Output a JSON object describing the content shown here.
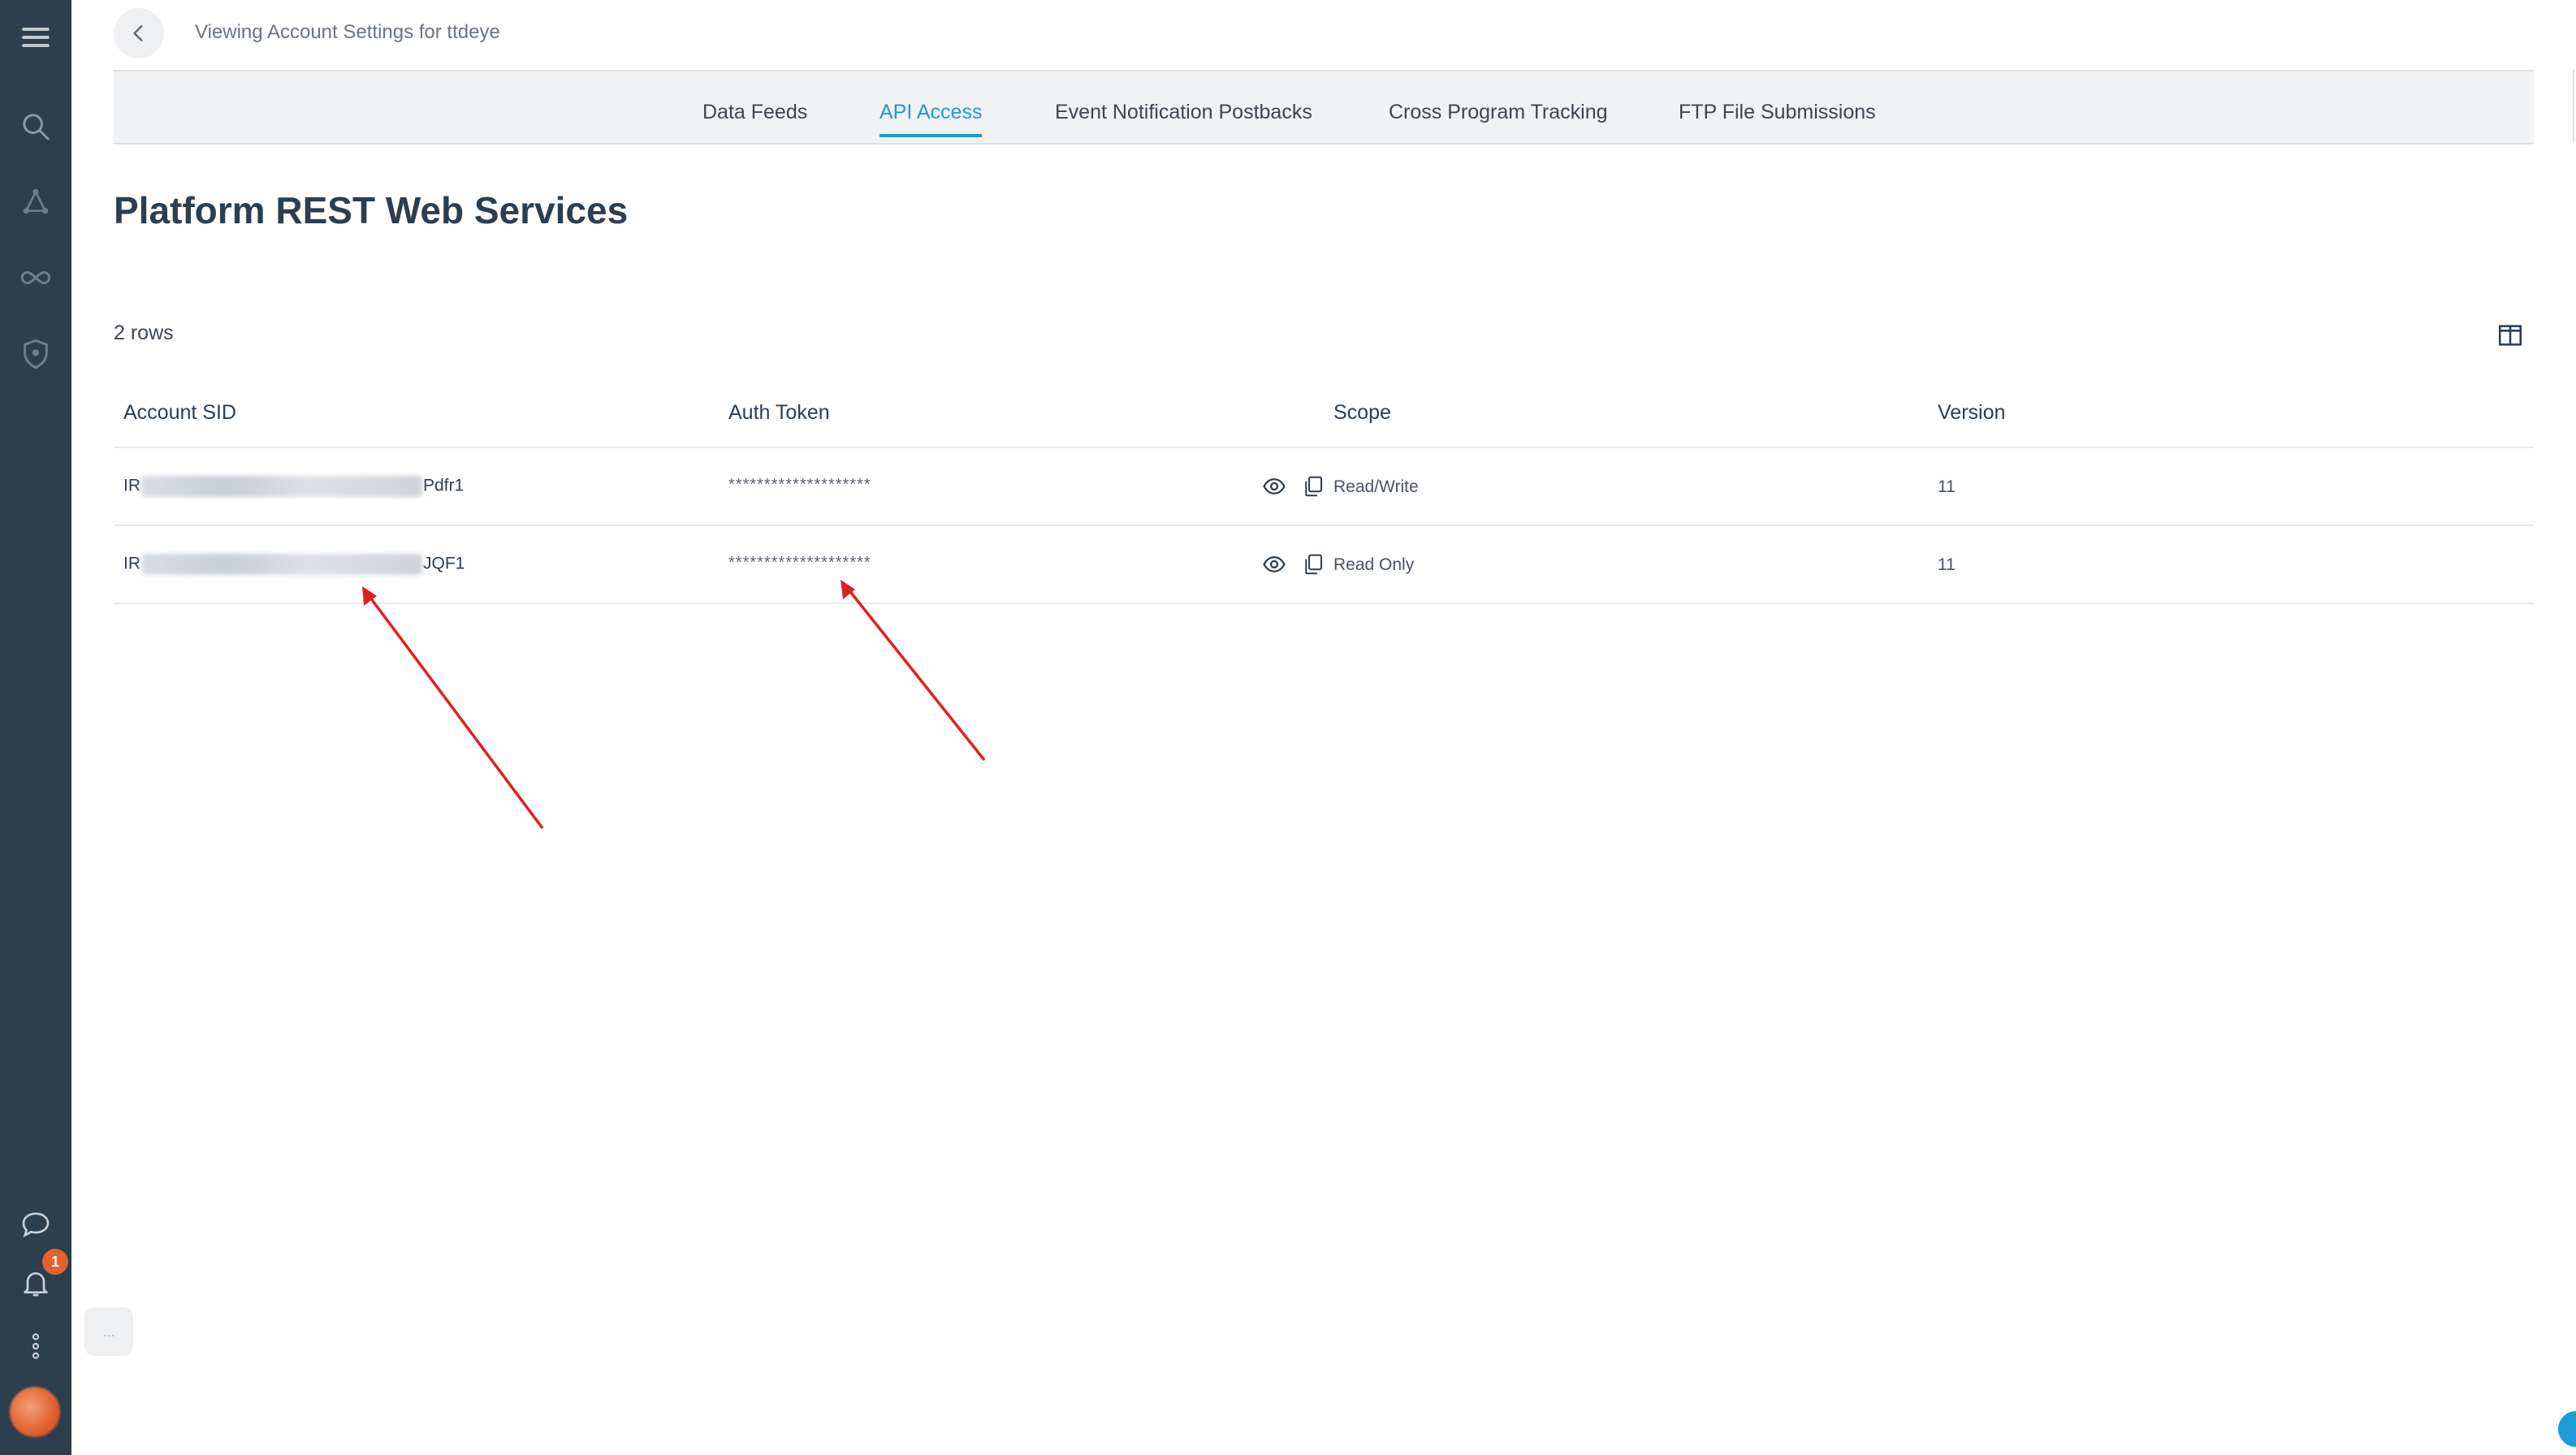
{
  "header": {
    "title": "Viewing Account Settings for ttdeye"
  },
  "tabs": [
    {
      "label": "Data Feeds",
      "active": false
    },
    {
      "label": "API Access",
      "active": true
    },
    {
      "label": "Event Notification Postbacks",
      "active": false
    },
    {
      "label": "Cross Program Tracking",
      "active": false
    },
    {
      "label": "FTP File Submissions",
      "active": false
    }
  ],
  "main": {
    "title": "Platform REST Web Services",
    "row_count": "2 rows"
  },
  "table": {
    "columns": [
      "Account SID",
      "Auth Token",
      "Scope",
      "Version"
    ],
    "rows": [
      {
        "sid_prefix": "IR",
        "sid_suffix": "Pdfr1",
        "token": "********************",
        "scope": "Read/Write",
        "version": "11"
      },
      {
        "sid_prefix": "IR",
        "sid_suffix": "JQF1",
        "token": "********************",
        "scope": "Read Only",
        "version": "11"
      }
    ]
  },
  "sidebar": {
    "notification_count": "1"
  },
  "chat_fab_label": "...",
  "colors": {
    "sidebar_bg": "#2d3e4f",
    "accent": "#1e9ad6",
    "badge": "#e5622c",
    "annotation_arrow": "#e02020"
  },
  "icons": [
    "menu-icon",
    "search-icon",
    "network-icon",
    "infinity-icon",
    "shield-icon",
    "chat-icon",
    "bell-icon",
    "more-vertical-icon",
    "eye-icon",
    "copy-icon",
    "columns-icon",
    "chevron-left-icon"
  ]
}
